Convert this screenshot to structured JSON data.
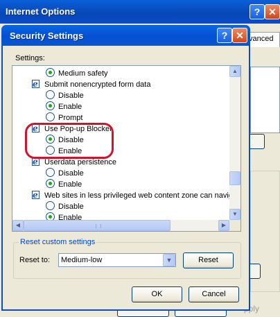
{
  "background_window": {
    "title": "Internet Options",
    "help_glyph": "?",
    "close_glyph": "✕",
    "tab_fragment": "vanced",
    "apply_fragment": "pply"
  },
  "dialog": {
    "title": "Security Settings",
    "help_glyph": "?",
    "close_glyph": "✕",
    "settings_label": "Settings:"
  },
  "settings_list": [
    {
      "kind": "option",
      "label": "Medium safety",
      "selected": true
    },
    {
      "kind": "header",
      "label": "Submit nonencrypted form data",
      "icon": "ie-settings-icon"
    },
    {
      "kind": "option",
      "label": "Disable",
      "selected": false
    },
    {
      "kind": "option",
      "label": "Enable",
      "selected": true
    },
    {
      "kind": "option",
      "label": "Prompt",
      "selected": false
    },
    {
      "kind": "header",
      "label": "Use Pop-up Blocker",
      "icon": "ie-settings-icon"
    },
    {
      "kind": "option",
      "label": "Disable",
      "selected": true
    },
    {
      "kind": "option",
      "label": "Enable",
      "selected": false
    },
    {
      "kind": "header",
      "label": "Userdata persistence",
      "icon": "ie-settings-icon"
    },
    {
      "kind": "option",
      "label": "Disable",
      "selected": false
    },
    {
      "kind": "option",
      "label": "Enable",
      "selected": true
    },
    {
      "kind": "header",
      "label": "Web sites in less privileged web content zone can navig",
      "icon": "ie-settings-icon"
    },
    {
      "kind": "option",
      "label": "Disable",
      "selected": false
    },
    {
      "kind": "option",
      "label": "Enable",
      "selected": true
    }
  ],
  "reset": {
    "group_label": "Reset custom settings",
    "reset_to_label": "Reset to:",
    "selected_level": "Medium-low",
    "reset_button": "Reset"
  },
  "buttons": {
    "ok": "OK",
    "cancel": "Cancel"
  },
  "colors": {
    "highlight_border": "#d0142b",
    "title_bar": "#0a56d0",
    "radio_dot": "#21a121"
  }
}
